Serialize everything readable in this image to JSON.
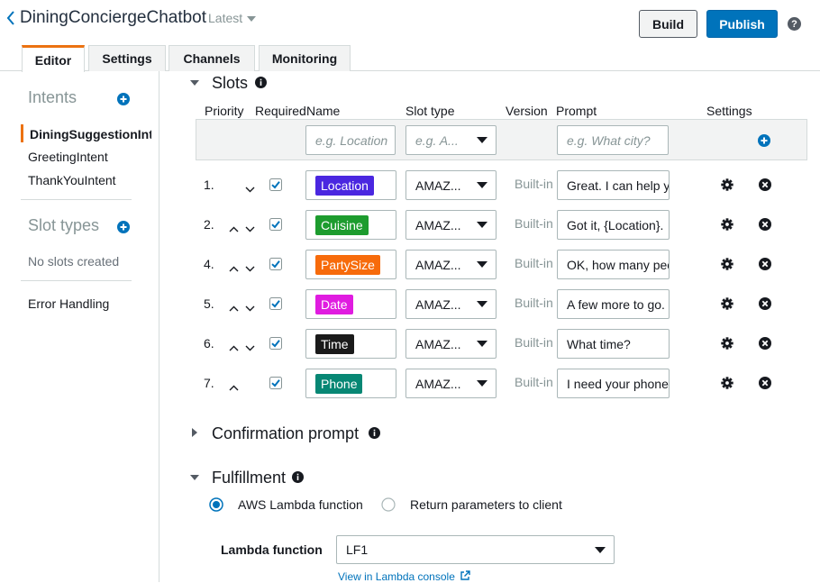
{
  "header": {
    "bot_name": "DiningConciergeChatbot",
    "version": "Latest",
    "build_label": "Build",
    "publish_label": "Publish",
    "help": "?"
  },
  "tabs": [
    "Editor",
    "Settings",
    "Channels",
    "Monitoring"
  ],
  "sidebar": {
    "intents_heading": "Intents",
    "intents": [
      "DiningSuggestionIntent",
      "GreetingIntent",
      "ThankYouIntent"
    ],
    "slot_types_heading": "Slot types",
    "no_slots": "No slots created",
    "error_handling": "Error Handling"
  },
  "slots": {
    "title": "Slots",
    "columns": {
      "priority": "Priority",
      "required": "Required",
      "name": "Name",
      "slot_type": "Slot type",
      "version": "Version",
      "prompt": "Prompt",
      "settings": "Settings"
    },
    "new_row": {
      "name_placeholder": "e.g. Location",
      "type_placeholder": "e.g. A...",
      "prompt_placeholder": "e.g. What city?"
    },
    "rows": [
      {
        "num": "1.",
        "name": "Location",
        "color": "#4a27e0",
        "type": "AMAZ...",
        "version": "Built-in",
        "prompt": "Great. I can help you",
        "up": false,
        "down": true
      },
      {
        "num": "2.",
        "name": "Cuisine",
        "color": "#1d9c2e",
        "type": "AMAZ...",
        "version": "Built-in",
        "prompt": "Got it, {Location}.",
        "up": true,
        "down": true
      },
      {
        "num": "4.",
        "name": "PartySize",
        "color": "#f76b0b",
        "type": "AMAZ...",
        "version": "Built-in",
        "prompt": "OK, how many people",
        "up": true,
        "down": true
      },
      {
        "num": "5.",
        "name": "Date",
        "color": "#e01ce0",
        "type": "AMAZ...",
        "version": "Built-in",
        "prompt": "A few more to go.",
        "up": true,
        "down": true
      },
      {
        "num": "6.",
        "name": "Time",
        "color": "#1a1a1a",
        "type": "AMAZ...",
        "version": "Built-in",
        "prompt": "What time?",
        "up": true,
        "down": true
      },
      {
        "num": "7.",
        "name": "Phone",
        "color": "#078774",
        "type": "AMAZ...",
        "version": "Built-in",
        "prompt": "I need your phone",
        "up": true,
        "down": false
      }
    ]
  },
  "confirmation": {
    "title": "Confirmation prompt"
  },
  "fulfillment": {
    "title": "Fulfillment",
    "option_lambda": "AWS Lambda function",
    "option_return": "Return parameters to client",
    "lambda_label": "Lambda function",
    "lambda_value": "LF1",
    "console_link": "View in Lambda console"
  }
}
